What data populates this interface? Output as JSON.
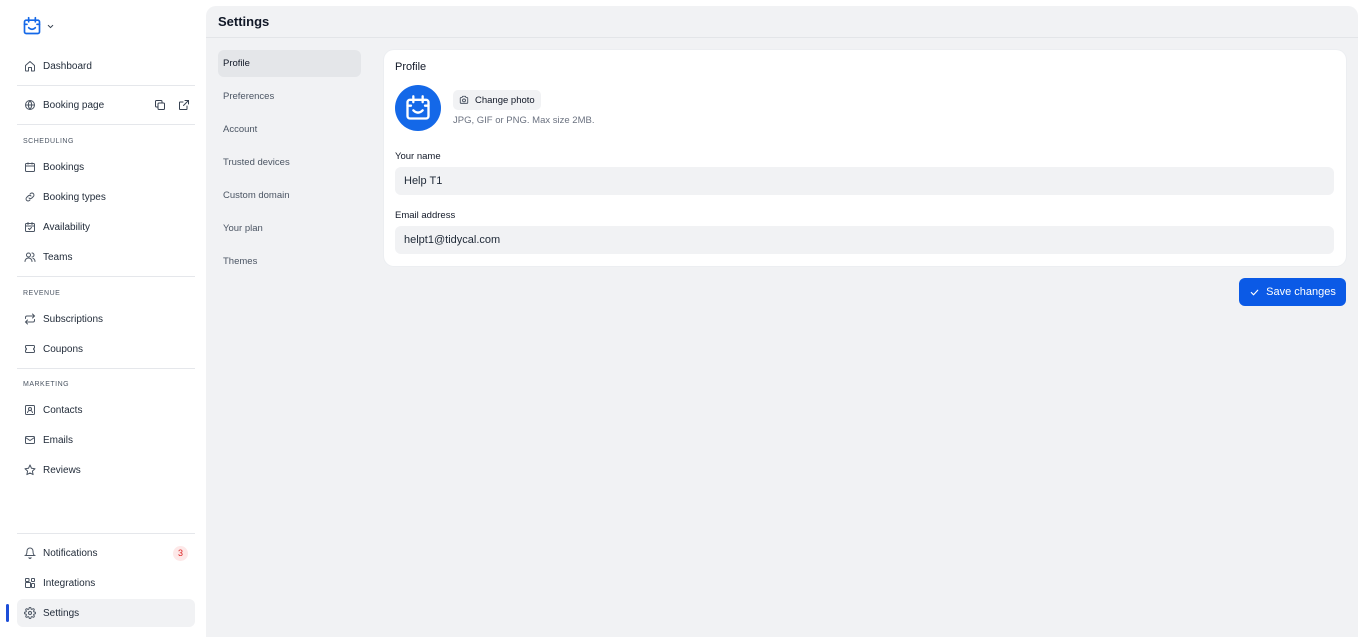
{
  "colors": {
    "accent": "#0b5ae6",
    "avatar_bg": "#1468e8",
    "badge_bg": "#fde8e8",
    "badge_text": "#dc2626",
    "main_bg": "#f1f2f4"
  },
  "sidebar": {
    "logo_icon": "calendar-check-icon",
    "dashboard": "Dashboard",
    "booking_page": "Booking page",
    "sections": {
      "scheduling": "SCHEDULING",
      "revenue": "REVENUE",
      "marketing": "MARKETING"
    },
    "scheduling_items": [
      "Bookings",
      "Booking types",
      "Availability",
      "Teams"
    ],
    "revenue_items": [
      "Subscriptions",
      "Coupons"
    ],
    "marketing_items": [
      "Contacts",
      "Emails",
      "Reviews"
    ],
    "notifications": {
      "label": "Notifications",
      "count": "3"
    },
    "integrations": "Integrations",
    "settings": "Settings"
  },
  "header": {
    "title": "Settings"
  },
  "settings_nav": [
    "Profile",
    "Preferences",
    "Account",
    "Trusted devices",
    "Custom domain",
    "Your plan",
    "Themes"
  ],
  "profile": {
    "title": "Profile",
    "change_photo": "Change photo",
    "photo_hint": "JPG, GIF or PNG. Max size 2MB.",
    "name_label": "Your name",
    "name_value": "Help T1",
    "email_label": "Email address",
    "email_value": "helpt1@tidycal.com"
  },
  "save_button": "Save changes"
}
